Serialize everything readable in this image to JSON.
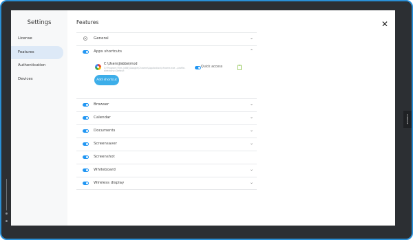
{
  "window": {
    "title": "Settings",
    "close_glyph": "✕"
  },
  "sidebar": {
    "items": [
      {
        "label": "License",
        "active": false
      },
      {
        "label": "Features",
        "active": true
      },
      {
        "label": "Authentication",
        "active": false
      },
      {
        "label": "Devices",
        "active": false
      }
    ]
  },
  "main": {
    "title": "Features",
    "features": [
      {
        "label": "General",
        "icon": "gear-icon",
        "expanded": false
      },
      {
        "label": "Apps shortcuts",
        "toggle": true,
        "expanded": true
      },
      {
        "label": "Browser",
        "toggle": true,
        "expanded": false
      },
      {
        "label": "Calendar",
        "toggle": true,
        "expanded": false
      },
      {
        "label": "Documents",
        "toggle": true,
        "expanded": false
      },
      {
        "label": "Screensaver",
        "toggle": true,
        "expanded": false
      },
      {
        "label": "Screenshot",
        "toggle": true,
        "expanded": false
      },
      {
        "label": "Whiteboard",
        "toggle": true,
        "expanded": false
      },
      {
        "label": "Wireless display",
        "toggle": true,
        "expanded": false
      }
    ],
    "shortcut": {
      "app_name": "C:\\Users\\jlabbe\\mod",
      "app_path": "C:\\Program Files (x86)\\Google\\Chrome\\Application\\chrome.exe --profile-directory=Default",
      "quick_access_label": "Quick access",
      "quick_access_on": true,
      "add_button_label": "Add shortcut"
    }
  },
  "side_tab": {
    "label": "CONSOLE"
  },
  "colors": {
    "accent": "#2196f3",
    "button": "#3daee9",
    "bezel_border": "#2a8fd6"
  }
}
